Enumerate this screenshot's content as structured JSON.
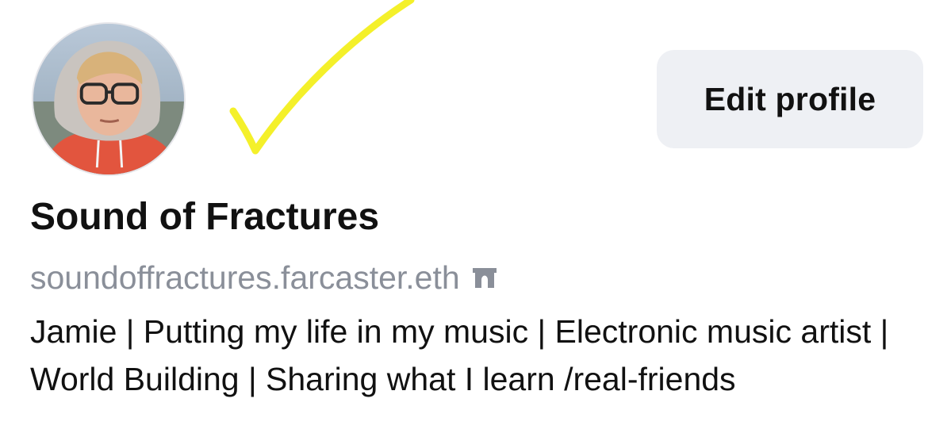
{
  "profile": {
    "display_name": "Sound of Fractures",
    "username": "soundoffractures.farcaster.eth",
    "bio": "Jamie | Putting my life in my music | Electronic music artist | World Building | Sharing what I learn /real-friends",
    "edit_button_label": "Edit profile",
    "verified_icon": "arch-icon",
    "avatar": "avatar-photo"
  },
  "colors": {
    "button_bg": "#eef0f4",
    "username_gray": "#8a8f99",
    "annotation_yellow": "#f4f02a",
    "text": "#111111"
  }
}
